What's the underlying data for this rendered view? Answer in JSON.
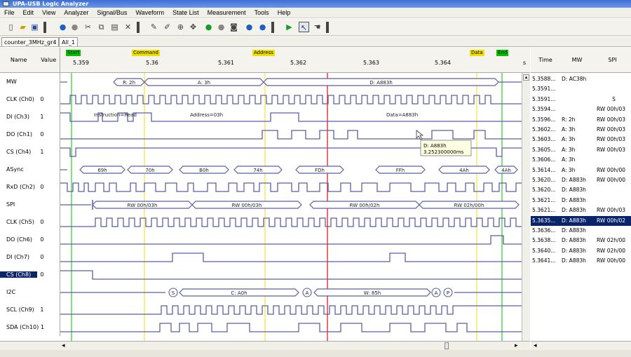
{
  "window": {
    "title": "UPA-USB Logic Analyzer"
  },
  "menu": [
    "File",
    "Edit",
    "View",
    "Analyzer",
    "Signal/Bus",
    "Waveform",
    "State List",
    "Measurement",
    "Tools",
    "Help"
  ],
  "tabs": [
    "counter_3MHz_gr4",
    "All_1"
  ],
  "header": {
    "name": "Name",
    "value": "Value"
  },
  "markers": [
    {
      "label": "Start",
      "color": "#00c000"
    },
    {
      "label": "Command",
      "color": "#f0e000"
    },
    {
      "label": "Address",
      "color": "#f0e000"
    },
    {
      "label": "Data",
      "color": "#f0e000"
    },
    {
      "label": "End",
      "color": "#00c000"
    }
  ],
  "ticks": [
    "5.359",
    "5.36",
    "5.361",
    "5.362",
    "5.363",
    "5.364"
  ],
  "tick_unit": "s",
  "rows": [
    {
      "name": "MW",
      "value": ""
    },
    {
      "name": "CLK (Ch0)",
      "value": "0"
    },
    {
      "name": "DI (Ch3)",
      "value": "1"
    },
    {
      "name": "DO (Ch1)",
      "value": "0"
    },
    {
      "name": "CS (Ch4)",
      "value": "1"
    },
    {
      "name": "ASync",
      "value": ""
    },
    {
      "name": "RxD (Ch2)",
      "value": "0"
    },
    {
      "name": "SPI",
      "value": ""
    },
    {
      "name": "CLK (Ch5)",
      "value": "0"
    },
    {
      "name": "DO (Ch6)",
      "value": "0"
    },
    {
      "name": "DI (Ch7)",
      "value": "0"
    },
    {
      "name": "CS (Ch8)",
      "value": "0"
    },
    {
      "name": "I2C",
      "value": ""
    },
    {
      "name": "SCL (Ch9)",
      "value": "1"
    },
    {
      "name": "SDA (Ch10)",
      "value": "1"
    }
  ],
  "wave_labels": {
    "mw": [
      "R: 2h",
      "A: 3h",
      "D: A883h"
    ],
    "di_annot": [
      "Instruction=Read",
      "Address=03h",
      "Data=A883h"
    ],
    "async": [
      "69h",
      "70h",
      "B0h",
      "74h",
      "FDh",
      "FFh",
      "4Ah",
      "4Ah"
    ],
    "spi": [
      "RW 00h/03h",
      "RW 00h/03h",
      "RW 00h/02h",
      "RW 02h/00h"
    ],
    "i2c": [
      "S",
      "C: A0h",
      "A",
      "W: 85h",
      "A",
      "P"
    ]
  },
  "tooltip": {
    "line1": "D: A883h",
    "line2": "3.252300000ms"
  },
  "right_panel": {
    "headers": [
      "Time",
      "MW",
      "SPI"
    ],
    "rows": [
      [
        "5.3588...",
        "D: AC38h",
        ""
      ],
      [
        "5.3591...",
        "",
        ""
      ],
      [
        "5.3591...",
        "",
        "S"
      ],
      [
        "5.3594...",
        "",
        "RW 00h/03"
      ],
      [
        "5.3596...",
        "R: 2h",
        "RW 00h/03"
      ],
      [
        "5.3602...",
        "A: 3h",
        "RW 00h/03"
      ],
      [
        "5.3603...",
        "A: 3h",
        "RW 00h/03"
      ],
      [
        "5.3605...",
        "A: 3h",
        "RW 00h/03"
      ],
      [
        "5.3606...",
        "A: 3h",
        ""
      ],
      [
        "5.3614...",
        "A: 3h",
        "RW 00h/00"
      ],
      [
        "5.3620...",
        "D: A883h",
        "RW 00h/00"
      ],
      [
        "5.3620...",
        "D: A883h",
        ""
      ],
      [
        "5.3621...",
        "D: A883h",
        ""
      ],
      [
        "5.3621...",
        "D: A883h",
        "RW 00h/03"
      ],
      [
        "5.3635...",
        "D: A883h",
        "RW 00h/02"
      ],
      [
        "5.3636...",
        "D: A883h",
        ""
      ],
      [
        "5.3638...",
        "D: A883h",
        "RW 02h/00"
      ],
      [
        "5.3640...",
        "D: A883h",
        "RW 02h/00"
      ],
      [
        "5.3641...",
        "D: A883h",
        "RW 00h/00"
      ]
    ],
    "selected_index": 14
  }
}
